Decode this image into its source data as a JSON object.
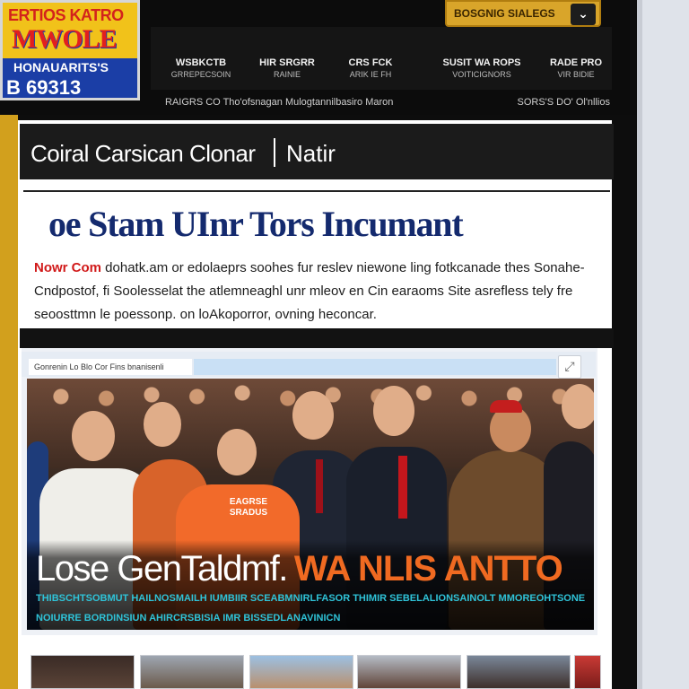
{
  "logo": {
    "line1": "ERTIOS KATRO",
    "line2": "MWOLE",
    "line3": "HONAUARITS'S",
    "line4": "B 69313"
  },
  "search": {
    "label": "BOSGNIG SIALEGS",
    "chevron_icon": "chevron-down-icon"
  },
  "nav": {
    "items": [
      {
        "label": "WSBKCTB",
        "sub": "GRREPECSOIN"
      },
      {
        "label": "HIR SRGRR",
        "sub": "RAINIE"
      },
      {
        "label": "CRS FCK",
        "sub": "ARIK IE FH"
      },
      {
        "label": "SUSIT WA ROPS",
        "sub": "VOITICIGNORS"
      },
      {
        "label": "RADE PRO",
        "sub": "VIR BIDIE"
      }
    ]
  },
  "ticker": {
    "left": "RAIGRS CO Tho'ofsnagan Mulogtannilbasiro Maron",
    "right": "SORS'S DO' Ol'nllios"
  },
  "section": {
    "title": "Coiral Carsican Clonar",
    "tab": "Natir"
  },
  "article": {
    "headline": "oe Stam UInr Tors Incumant",
    "kicker": "Nowr Com",
    "lede": "dohatk.am or edolaeprs soohes fur reslev niewone ling fotkcanade thes Sonahe-Cndpostof, fi Soolesselat the atlemneaghl unr mleov en Cin earaoms Site asrefless tely fre seoosttmn le poessonp. on loAkoporror, ovning heconcar."
  },
  "photo": {
    "caption": "Gonrenin Lo Blo Cor Fins bnanisenli",
    "expand_icon": "expand-icon",
    "shirt_text": "EAGRSE SRADUS",
    "title_main": "Lose GenTaldmf.",
    "title_accent": "WA NLIS ANTTO",
    "subline1": "THIBSCHTSOBMUT HAILNOSMAILH IUMBIIR SCEABMNIRLFASOR THIMIR SEBELALIONSAINOLT MMOREOHTSONEE",
    "subline2": "NOIURRE BORDINSIUN AHIRCRSBISIA IMR BISSEDLANAVINICN"
  },
  "colors": {
    "header_bg": "#0c0c0c",
    "accent_gold": "#d2a01d",
    "headline_blue": "#142a6e",
    "kicker_red": "#d11a1a",
    "title_orange": "#f06a21",
    "subline_cyan": "#2fc3d8"
  }
}
